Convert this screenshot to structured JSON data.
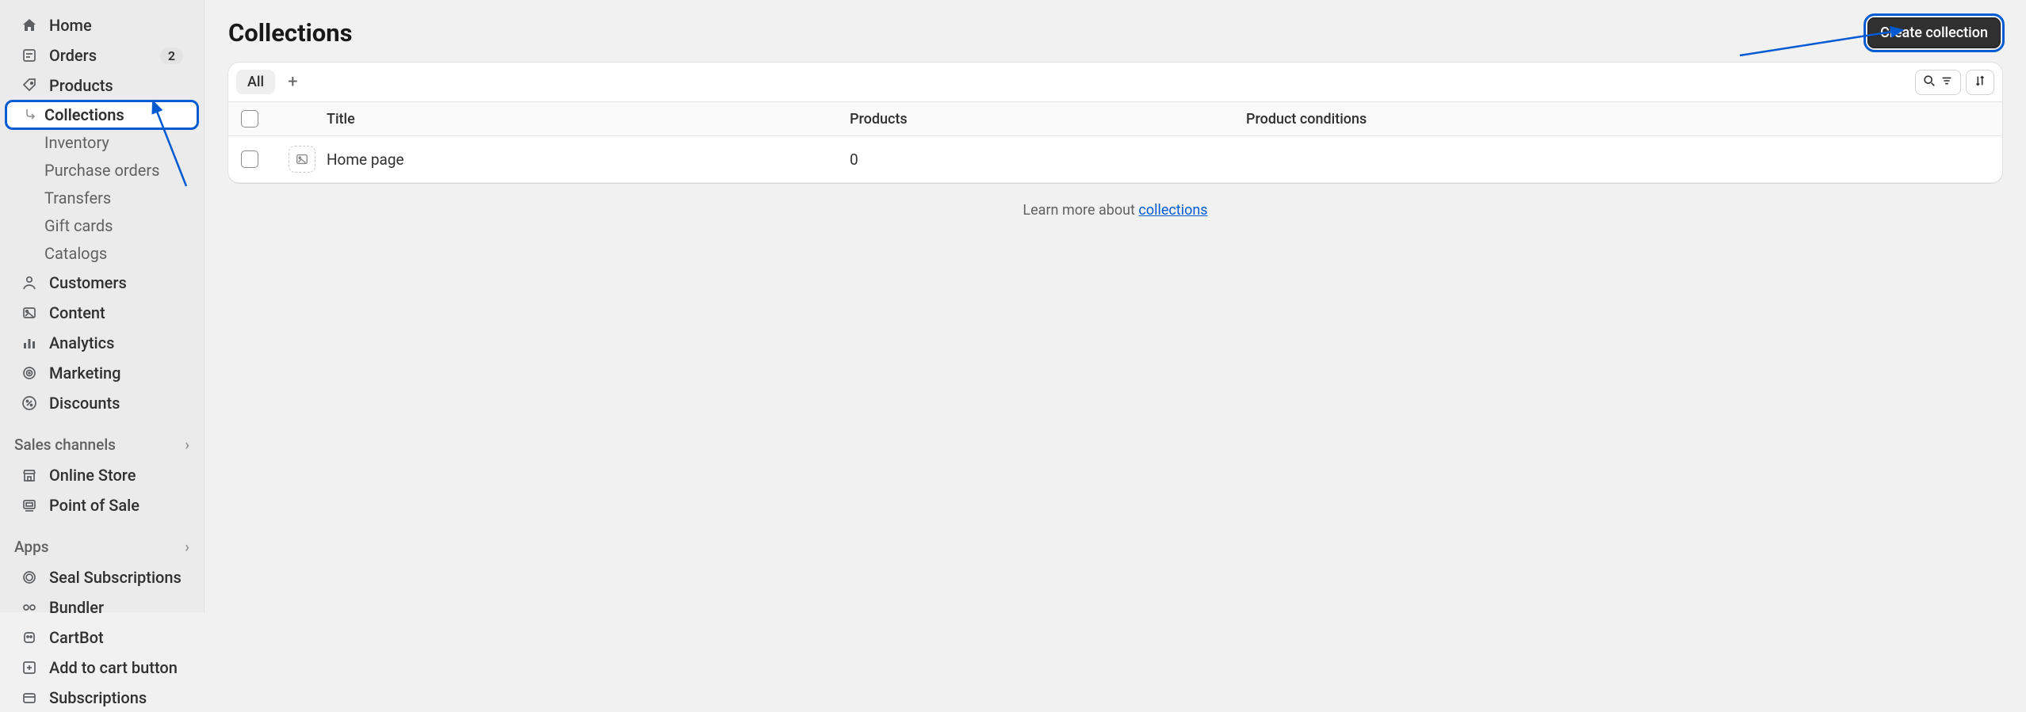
{
  "sidebar": {
    "home": "Home",
    "orders": {
      "label": "Orders",
      "badge": "2"
    },
    "products": "Products",
    "products_children": {
      "collections": "Collections",
      "inventory": "Inventory",
      "purchase_orders": "Purchase orders",
      "transfers": "Transfers",
      "gift_cards": "Gift cards",
      "catalogs": "Catalogs"
    },
    "customers": "Customers",
    "content": "Content",
    "analytics": "Analytics",
    "marketing": "Marketing",
    "discounts": "Discounts",
    "section_sales_channels": "Sales channels",
    "online_store": "Online Store",
    "pos": "Point of Sale",
    "section_apps": "Apps",
    "seal": "Seal Subscriptions",
    "bundler": "Bundler",
    "cartbot": "CartBot",
    "add_to_cart": "Add to cart button",
    "subscriptions": "Subscriptions"
  },
  "header": {
    "title": "Collections",
    "create_btn": "Create collection"
  },
  "tabs": {
    "all": "All",
    "plus": "+"
  },
  "table": {
    "headers": {
      "title": "Title",
      "products": "Products",
      "conditions": "Product conditions"
    },
    "rows": [
      {
        "title": "Home page",
        "products": "0",
        "conditions": ""
      }
    ]
  },
  "footer": {
    "text": "Learn more about ",
    "link": "collections"
  }
}
